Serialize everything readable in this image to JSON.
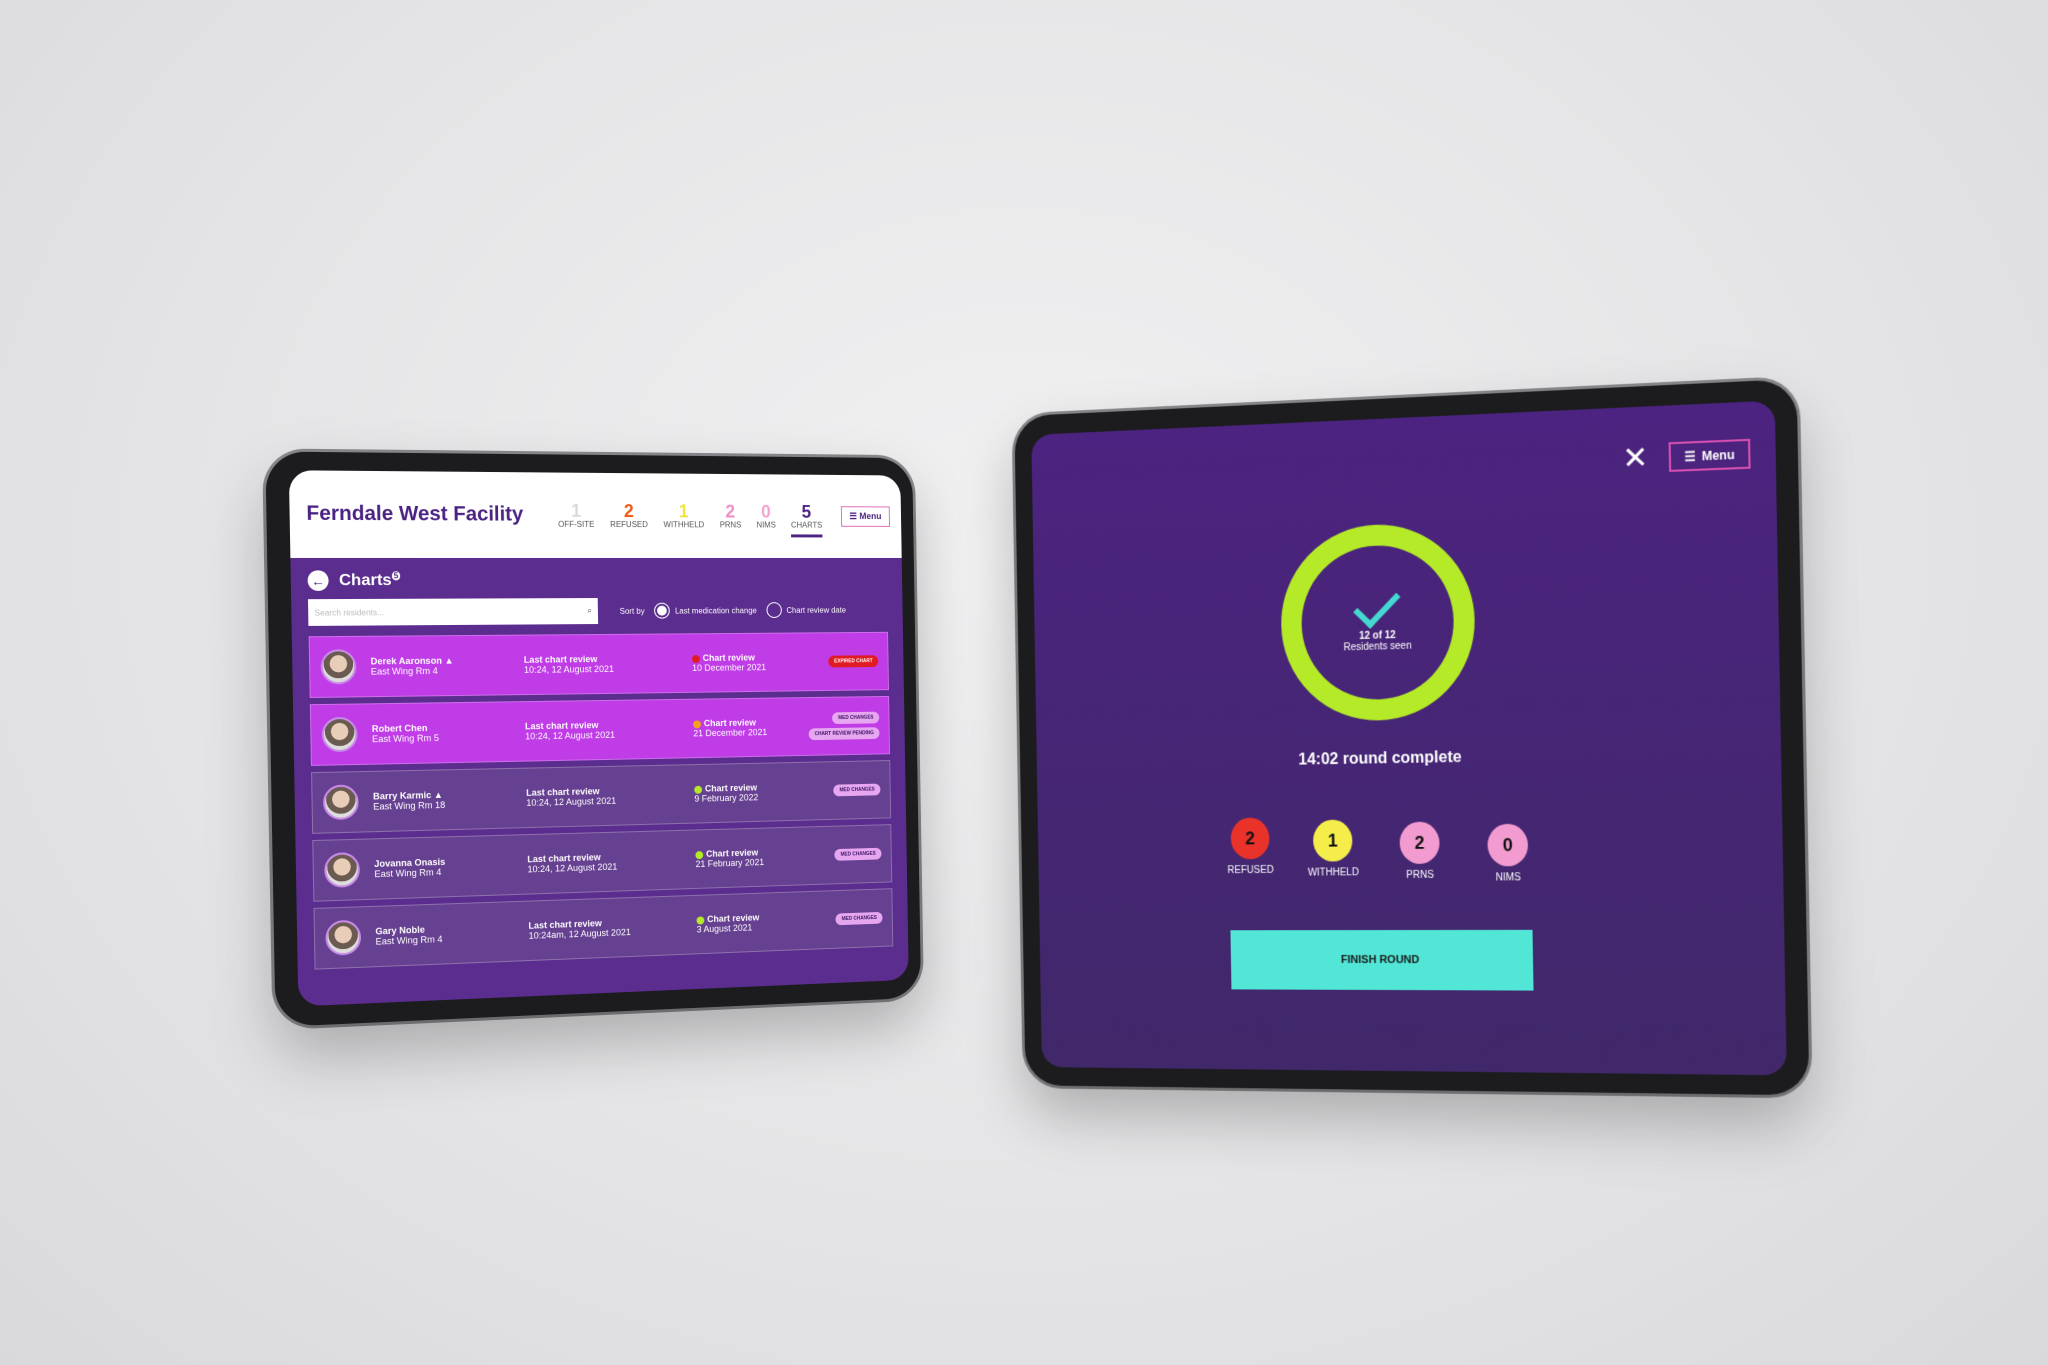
{
  "left": {
    "title": "Ferndale West Facility",
    "stats": [
      {
        "value": "1",
        "label": "OFF-SITE",
        "color": "#d9d9d9"
      },
      {
        "value": "2",
        "label": "REFUSED",
        "color": "#f05a14"
      },
      {
        "value": "1",
        "label": "WITHHELD",
        "color": "#f2e33c"
      },
      {
        "value": "2",
        "label": "PRNS",
        "color": "#ef8dc7"
      },
      {
        "value": "0",
        "label": "NIMS",
        "color": "#f4a3d2"
      },
      {
        "value": "5",
        "label": "CHARTS",
        "color": "#4b2383"
      }
    ],
    "menu": "Menu",
    "charts_title": "Charts",
    "charts_badge": "5",
    "search_placeholder": "Search residents...",
    "sort_by": "Sort by",
    "sort_options": [
      "Last medication change",
      "Chart review date"
    ],
    "residents": [
      {
        "name": "Derek Aaronson ▲",
        "room": "East Wing Rm 4",
        "last_label": "Last chart review",
        "last": "10:24, 12 August 2021",
        "review_label": "Chart review",
        "review": "10 December 2021",
        "dot": "#e01b24",
        "tags": [
          "EXPIRED CHART"
        ]
      },
      {
        "name": "Robert Chen",
        "room": "East Wing Rm 5",
        "last_label": "Last chart review",
        "last": "10:24, 12 August 2021",
        "review_label": "Chart review",
        "review": "21 December 2021",
        "dot": "#f5a020",
        "tags": [
          "MED CHANGES",
          "CHART REVIEW PENDING"
        ]
      },
      {
        "name": "Barry Karmic ▲",
        "room": "East Wing Rm 18",
        "last_label": "Last chart review",
        "last": "10:24, 12 August 2021",
        "review_label": "Chart review",
        "review": "9 February 2022",
        "dot": "#b4ea28",
        "tags": [
          "MED CHANGES"
        ]
      },
      {
        "name": "Jovanna Onasis",
        "room": "East Wing Rm 4",
        "last_label": "Last chart review",
        "last": "10:24, 12 August 2021",
        "review_label": "Chart review",
        "review": "21 February 2021",
        "dot": "#b4ea28",
        "tags": [
          "MED CHANGES"
        ]
      },
      {
        "name": "Gary Noble",
        "room": "East Wing Rm 4",
        "last_label": "Last chart review",
        "last": "10:24am, 12 August 2021",
        "review_label": "Chart review",
        "review": "3 August 2021",
        "dot": "#b4ea28",
        "tags": [
          "MED CHANGES"
        ]
      }
    ]
  },
  "right": {
    "menu": "Menu",
    "seen_count": "12 of 12",
    "seen_label": "Residents seen",
    "progress": 1.0,
    "round_complete": "14:02 round complete",
    "counts": [
      {
        "value": "2",
        "label": "REFUSED",
        "color": "#e8322a"
      },
      {
        "value": "1",
        "label": "WITHHELD",
        "color": "#f5ee4a"
      },
      {
        "value": "2",
        "label": "PRNS",
        "color": "#f29bd0"
      },
      {
        "value": "0",
        "label": "NIMS",
        "color": "#f29bd0"
      }
    ],
    "finish": "FINISH ROUND"
  }
}
